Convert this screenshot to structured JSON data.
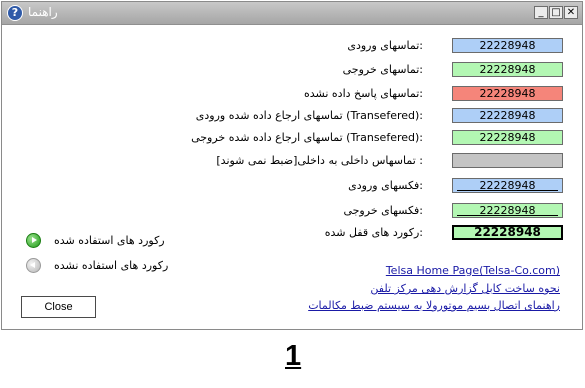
{
  "window": {
    "title": "راهنما",
    "help_glyph": "?",
    "minimize_glyph": "_",
    "maximize_glyph": "□",
    "close_glyph": "✕"
  },
  "rows": [
    {
      "label": ":تماسهای ورودی",
      "value": "22228948",
      "color": "#aecff7"
    },
    {
      "label": ":تماسهای خروجی",
      "value": "22228948",
      "color": "#b3f7b3"
    },
    {
      "label": ":تماسهای پاسخ داده نشده",
      "value": "22228948",
      "color": "#f5857a"
    },
    {
      "label": ":(Transefered) تماسهای ارجاع داده شده ورودی",
      "value": "22228948",
      "color": "#aecff7"
    },
    {
      "label": ":(Transefered) تماسهای ارجاع داده شده خروجی",
      "value": "22228948",
      "color": "#b3f7b3"
    },
    {
      "label": ": تماسهاس داخلی به داخلی[ضبط نمی شوند]",
      "value": "",
      "color": "#c4c4c4"
    },
    {
      "label": ":فکسهای ورودی",
      "value": "22228948",
      "color": "#aecff7"
    },
    {
      "label": ":فکسهای خروجی",
      "value": "22228948",
      "color": "#b3f7b3"
    },
    {
      "label": ":رکورد های قفل شده",
      "value": "22228948",
      "color": "#b3f7b3"
    }
  ],
  "legend": {
    "used_label": "رکورد های استفاده شده",
    "unused_label": "رکورد های استفاده نشده"
  },
  "links": {
    "home_page": "Telsa Home Page(Telsa-Co.com)",
    "report_cable": "نحوه ساخت کابل گزارش دهی مرکز تلفن",
    "motorola_guide": "راهنمای اتصال بسیم موتورولا به سیستم ضبط مکالمات"
  },
  "close_button": {
    "label": "Close"
  },
  "page_number": "1"
}
